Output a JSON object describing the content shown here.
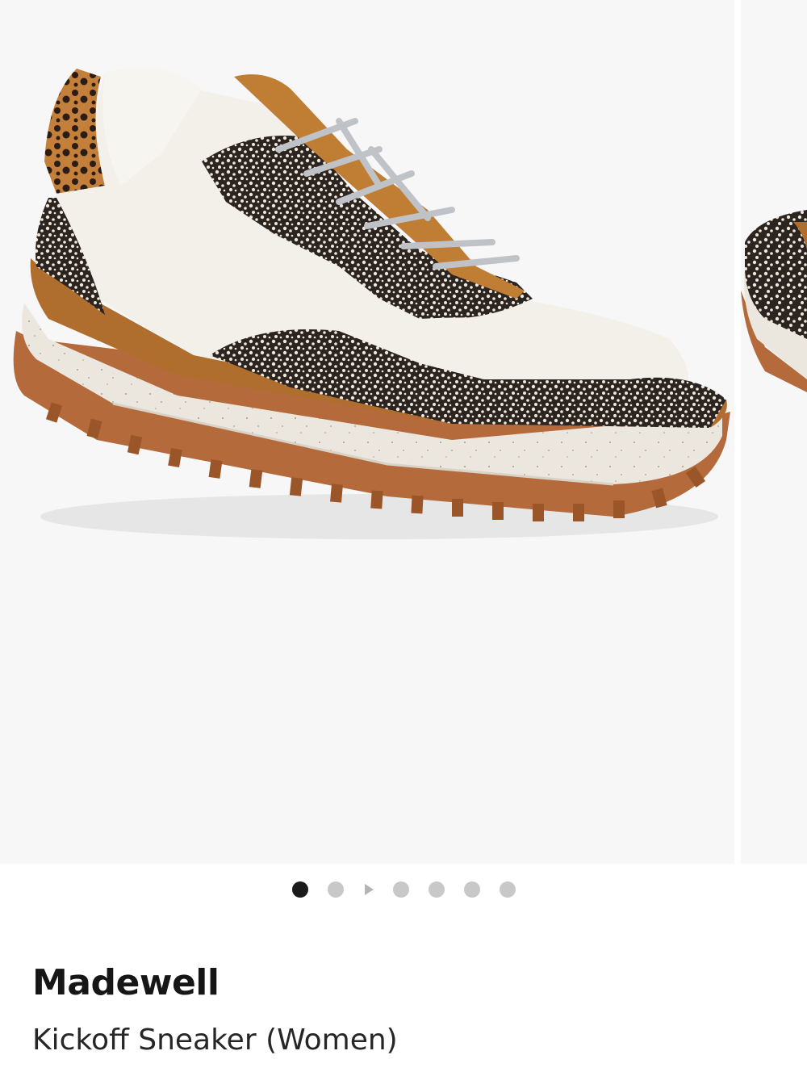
{
  "carousel": {
    "slides": [
      {
        "image": "madewell-kickoff-sneaker-side-view"
      },
      {
        "image": "madewell-kickoff-sneaker-alternate-view"
      }
    ],
    "pagination": {
      "current_page": 1,
      "items": [
        "image",
        "image",
        "video",
        "image",
        "image",
        "image",
        "image"
      ]
    }
  },
  "product": {
    "brand": "Madewell",
    "name": "Kickoff Sneaker (Women)"
  },
  "colors": {
    "background": "#ffffff",
    "image_backdrop": "#f7f7f7",
    "dot_active": "#1a1a1a",
    "dot_inactive": "#c8c8c8",
    "text_primary": "#161616"
  }
}
